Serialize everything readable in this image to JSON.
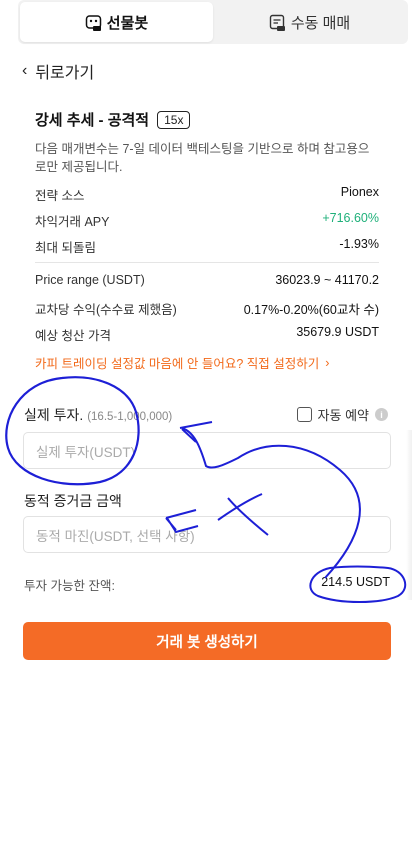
{
  "tabs": [
    {
      "label": "선물봇",
      "icon": "futures-bot-icon",
      "active": true
    },
    {
      "label": "수동 매매",
      "icon": "manual-trade-icon",
      "active": false
    }
  ],
  "back": {
    "label": "뒤로가기"
  },
  "strategy": {
    "title": "강세 추세 - 공격적",
    "leverage": "15x",
    "description": "다음 매개변수는 7-일 데이터 백테스팅을 기반으로 하며 참고용으로만 제공됩니다."
  },
  "details": [
    {
      "key": "전략 소스",
      "value": "Pionex",
      "color": "#111111"
    },
    {
      "key": "차익거래 APY",
      "value": "+716.60%",
      "color": "#1fb07a"
    },
    {
      "key": "최대 되돌림",
      "value": "-1.93%",
      "color": "#111111"
    }
  ],
  "params": [
    {
      "key": "Price range (USDT)",
      "value": "36023.9 ~ 41170.2"
    },
    {
      "key": "교차당 수익(수수료 제했음)",
      "value": "0.17%-0.20%(60교차 수)"
    },
    {
      "key": "예상 청산 가격",
      "value": "35679.9 USDT"
    }
  ],
  "copy_link": "카피 트레이딩 설정값 마음에 안 들어요? 직접 설정하기",
  "investment": {
    "label": "실제 투자.",
    "range": "(16.5-1,000,000)",
    "placeholder": "실제 투자(USDT)",
    "auto_label": "자동 예약"
  },
  "margin": {
    "label": "동적 증거금 금액",
    "placeholder": "동적 마진(USDT, 선택 사항)"
  },
  "balance": {
    "label": "투자 가능한 잔액:",
    "value": "214.5 USDT"
  },
  "cta": "거래 봇 생성하기",
  "colors": {
    "accent": "#f46b26",
    "positive": "#1fb07a",
    "annotation": "#1d1fd6"
  }
}
